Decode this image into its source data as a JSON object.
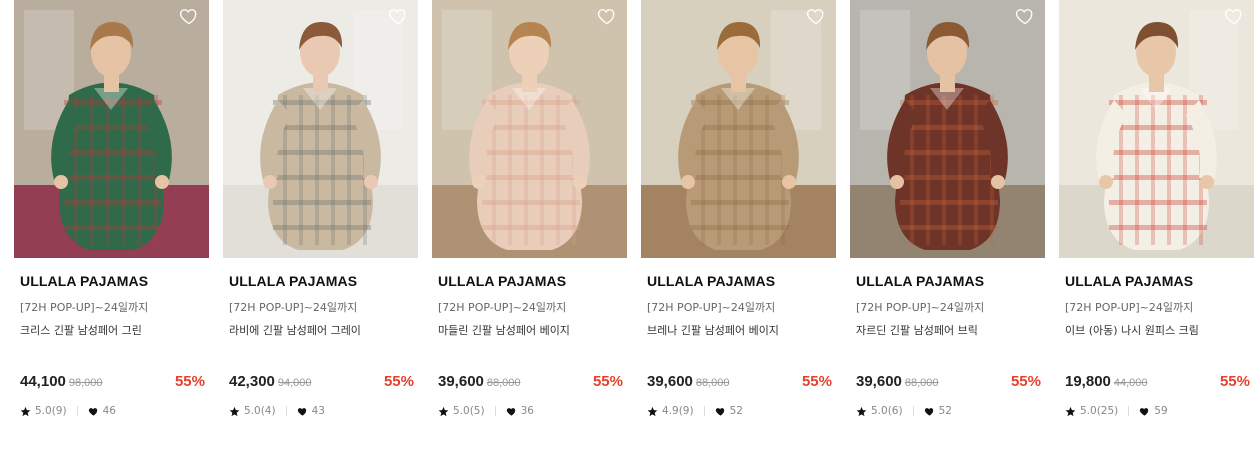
{
  "products": [
    {
      "brand": "ULLALA PAJAMAS",
      "promo": "[72H POP-UP]~24일까지",
      "name": "크리스 긴팔 남성페어 그린",
      "price": "44,100",
      "original_price": "98,000",
      "discount": "55%",
      "rating": "5.0(9)",
      "likes": "46",
      "image": {
        "bg": "#b9ad9d",
        "floor": "#8c2a45",
        "outfit": "#2f6b4b",
        "accent": "#b8393a",
        "skin": "#e6c3a5",
        "hair": "#a9794b"
      }
    },
    {
      "brand": "ULLALA PAJAMAS",
      "promo": "[72H POP-UP]~24일까지",
      "name": "라비에 긴팔 남성페어 그레이",
      "price": "42,300",
      "original_price": "94,000",
      "discount": "55%",
      "rating": "5.0(4)",
      "likes": "43",
      "image": {
        "bg": "#ecebe6",
        "floor": "#e0ddd6",
        "outfit": "#c9b9a0",
        "accent": "#6a6f6c",
        "skin": "#e9c9b1",
        "hair": "#8a5a3a"
      }
    },
    {
      "brand": "ULLALA PAJAMAS",
      "promo": "[72H POP-UP]~24일까지",
      "name": "마들린 긴팔 남성페어 베이지",
      "price": "39,600",
      "original_price": "88,000",
      "discount": "55%",
      "rating": "5.0(5)",
      "likes": "36",
      "image": {
        "bg": "#cfc3ad",
        "floor": "#a98a6a",
        "outfit": "#e9cdbb",
        "accent": "#d99e86",
        "skin": "#edd0b8",
        "hair": "#b58450"
      }
    },
    {
      "brand": "ULLALA PAJAMAS",
      "promo": "[72H POP-UP]~24일까지",
      "name": "브레나 긴팔 남성페어 베이지",
      "price": "39,600",
      "original_price": "88,000",
      "discount": "55%",
      "rating": "4.9(9)",
      "likes": "52",
      "image": {
        "bg": "#d8d0bf",
        "floor": "#9a7550",
        "outfit": "#b89b76",
        "accent": "#8d6a45",
        "skin": "#e7c4a4",
        "hair": "#9a6c3c"
      }
    },
    {
      "brand": "ULLALA PAJAMAS",
      "promo": "[72H POP-UP]~24일까지",
      "name": "자르딘 긴팔 남성페어 브릭",
      "price": "39,600",
      "original_price": "88,000",
      "discount": "55%",
      "rating": "5.0(6)",
      "likes": "52",
      "image": {
        "bg": "#b7b5ae",
        "floor": "#8d7a66",
        "outfit": "#6e3427",
        "accent": "#c9643c",
        "skin": "#e5c2a4",
        "hair": "#8b5a32"
      }
    },
    {
      "brand": "ULLALA PAJAMAS",
      "promo": "[72H POP-UP]~24일까지",
      "name": "이브 (아동) 나시 원피스 크림",
      "price": "19,800",
      "original_price": "44,000",
      "discount": "55%",
      "rating": "5.0(25)",
      "likes": "59",
      "image": {
        "bg": "#ece7dd",
        "floor": "#d9d3c8",
        "outfit": "#f4efe4",
        "accent": "#c7372b",
        "skin": "#e8c7a8",
        "hair": "#7c5031"
      }
    }
  ]
}
